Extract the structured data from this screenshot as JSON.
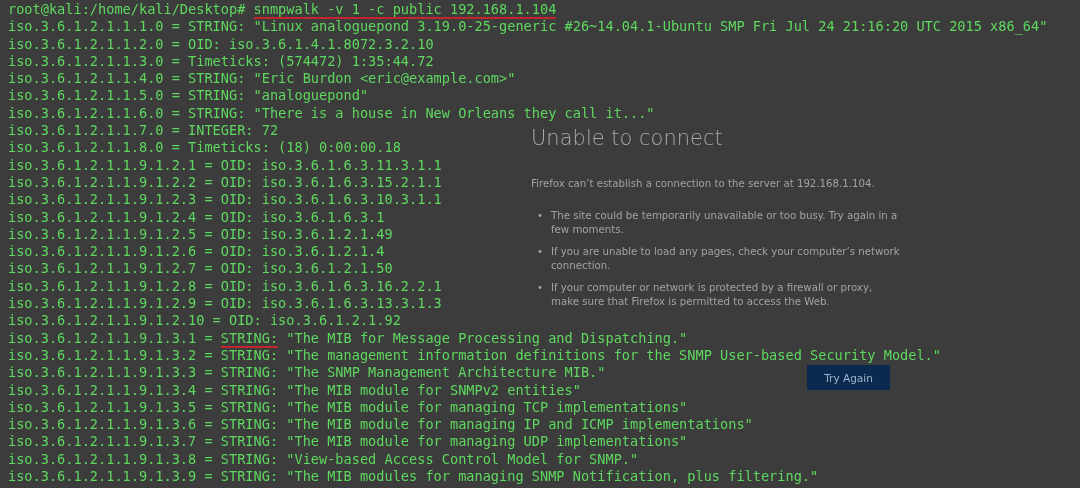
{
  "browser_page": {
    "title": "Unable to connect",
    "message": "Firefox can’t establish a connection to the server at 192.168.1.104.",
    "bullets": [
      {
        "marker": "•",
        "text": "The site could be temporarily unavailable or too busy. Try again in a few moments."
      },
      {
        "marker": "•",
        "text": "If you are unable to load any pages, check your computer’s network connection."
      },
      {
        "marker": "•",
        "text": "If your computer or network is protected by a firewall or proxy, make sure that Firefox is permitted to access the Web."
      }
    ],
    "button": "Try Again"
  },
  "terminal": {
    "lines": [
      {
        "segments": [
          {
            "text": "root@kali:/home/kali/Desktop# ",
            "underlined": false
          },
          {
            "text": "snmpwalk -v 1 -c public 192.168.1.104",
            "underlined": true
          }
        ]
      },
      {
        "segments": [
          {
            "text": "iso.3.6.1.2.1.1.1.0 = STRING: \"Linux analoguepond 3.19.0-25-generic #26~14.04.1-Ubuntu SMP Fri Jul 24 21:16:20 UTC 2015 x86_64\"",
            "underlined": false
          }
        ]
      },
      {
        "segments": [
          {
            "text": "iso.3.6.1.2.1.1.2.0 = OID: iso.3.6.1.4.1.8072.3.2.10",
            "underlined": false
          }
        ]
      },
      {
        "segments": [
          {
            "text": "iso.3.6.1.2.1.1.3.0 = Timeticks: (574472) 1:35:44.72",
            "underlined": false
          }
        ]
      },
      {
        "segments": [
          {
            "text": "iso.3.6.1.2.1.1.4.0 = STRING: \"Eric Burdon <eric@example.com>\"",
            "underlined": false
          }
        ]
      },
      {
        "segments": [
          {
            "text": "iso.3.6.1.2.1.1.5.0 = STRING: \"analoguepond\"",
            "underlined": false
          }
        ]
      },
      {
        "segments": [
          {
            "text": "iso.3.6.1.2.1.1.6.0 = STRING: \"There is a house in New Orleans they call it...\"",
            "underlined": false
          }
        ]
      },
      {
        "segments": [
          {
            "text": "iso.3.6.1.2.1.1.7.0 = INTEGER: 72",
            "underlined": false
          }
        ]
      },
      {
        "segments": [
          {
            "text": "iso.3.6.1.2.1.1.8.0 = Timeticks: (18) 0:00:00.18",
            "underlined": false
          }
        ]
      },
      {
        "segments": [
          {
            "text": "iso.3.6.1.2.1.1.9.1.2.1 = OID: iso.3.6.1.6.3.11.3.1.1",
            "underlined": false
          }
        ]
      },
      {
        "segments": [
          {
            "text": "iso.3.6.1.2.1.1.9.1.2.2 = OID: iso.3.6.1.6.3.15.2.1.1",
            "underlined": false
          }
        ]
      },
      {
        "segments": [
          {
            "text": "iso.3.6.1.2.1.1.9.1.2.3 = OID: iso.3.6.1.6.3.10.3.1.1",
            "underlined": false
          }
        ]
      },
      {
        "segments": [
          {
            "text": "iso.3.6.1.2.1.1.9.1.2.4 = OID: iso.3.6.1.6.3.1",
            "underlined": false
          }
        ]
      },
      {
        "segments": [
          {
            "text": "iso.3.6.1.2.1.1.9.1.2.5 = OID: iso.3.6.1.2.1.49",
            "underlined": false
          }
        ]
      },
      {
        "segments": [
          {
            "text": "iso.3.6.1.2.1.1.9.1.2.6 = OID: iso.3.6.1.2.1.4",
            "underlined": false
          }
        ]
      },
      {
        "segments": [
          {
            "text": "iso.3.6.1.2.1.1.9.1.2.7 = OID: iso.3.6.1.2.1.50",
            "underlined": false
          }
        ]
      },
      {
        "segments": [
          {
            "text": "iso.3.6.1.2.1.1.9.1.2.8 = OID: iso.3.6.1.6.3.16.2.2.1",
            "underlined": false
          }
        ]
      },
      {
        "segments": [
          {
            "text": "iso.3.6.1.2.1.1.9.1.2.9 = OID: iso.3.6.1.6.3.13.3.1.3",
            "underlined": false
          }
        ]
      },
      {
        "segments": [
          {
            "text": "iso.3.6.1.2.1.1.9.1.2.10 = OID: iso.3.6.1.2.1.92",
            "underlined": false
          }
        ]
      },
      {
        "segments": [
          {
            "text": "iso.3.6.1.2.1.1.9.1.3.1 = ",
            "underlined": false
          },
          {
            "text": "STRING:",
            "underlined": true
          },
          {
            "text": " \"The MIB for Message Processing and Dispatching.\"",
            "underlined": false
          }
        ]
      },
      {
        "segments": [
          {
            "text": "iso.3.6.1.2.1.1.9.1.3.2 = STRING: \"The management information definitions for the SNMP User-based Security Model.\"",
            "underlined": false
          }
        ]
      },
      {
        "segments": [
          {
            "text": "iso.3.6.1.2.1.1.9.1.3.3 = STRING: \"The SNMP Management Architecture MIB.\"",
            "underlined": false
          }
        ]
      },
      {
        "segments": [
          {
            "text": "iso.3.6.1.2.1.1.9.1.3.4 = STRING: \"The MIB module for SNMPv2 entities\"",
            "underlined": false
          }
        ]
      },
      {
        "segments": [
          {
            "text": "iso.3.6.1.2.1.1.9.1.3.5 = STRING: \"The MIB module for managing TCP implementations\"",
            "underlined": false
          }
        ]
      },
      {
        "segments": [
          {
            "text": "iso.3.6.1.2.1.1.9.1.3.6 = STRING: \"The MIB module for managing IP and ICMP implementations\"",
            "underlined": false
          }
        ]
      },
      {
        "segments": [
          {
            "text": "iso.3.6.1.2.1.1.9.1.3.7 = STRING: \"The MIB module for managing UDP implementations\"",
            "underlined": false
          }
        ]
      },
      {
        "segments": [
          {
            "text": "iso.3.6.1.2.1.1.9.1.3.8 = STRING: \"View-based Access Control Model for SNMP.\"",
            "underlined": false
          }
        ]
      },
      {
        "segments": [
          {
            "text": "iso.3.6.1.2.1.1.9.1.3.9 = STRING: \"The MIB modules for managing SNMP Notification, plus filtering.\"",
            "underlined": false
          }
        ]
      }
    ]
  }
}
